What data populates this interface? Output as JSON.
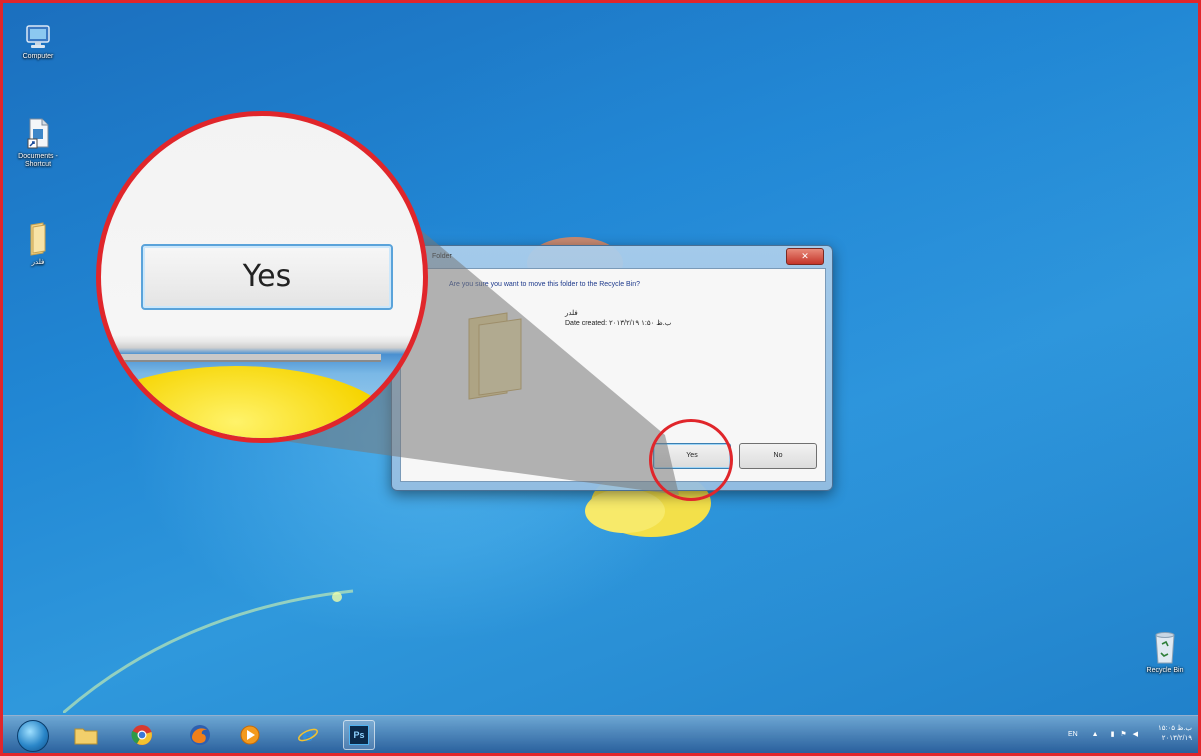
{
  "desktop": {
    "icons": [
      {
        "name": "computer",
        "label": "Computer"
      },
      {
        "name": "documents",
        "label": "Documents - Shortcut"
      },
      {
        "name": "folder",
        "label": "فلدر"
      },
      {
        "name": "recycle-bin",
        "label": "Recycle Bin"
      }
    ]
  },
  "dialog": {
    "title": "Folder",
    "close_label": "✕",
    "question": "Are you sure you want to move this folder to the Recycle Bin?",
    "folder_name": "فلدر",
    "date_created": "Date created: ۲۰۱۳/۲/۱۹ ب.ظ ۱:۵۰",
    "yes_label": "Yes",
    "no_label": "No"
  },
  "magnifier": {
    "yes_label": "Yes"
  },
  "taskbar": {
    "apps": [
      "windows-explorer",
      "chrome",
      "firefox",
      "media-player",
      "internet-explorer",
      "photoshop"
    ],
    "photoshop_label": "Ps",
    "tray_lang": "EN",
    "clock_time": "۱۵:۰۵ ب.ظ",
    "clock_date": "۲۰۱۳/۲/۱۹"
  },
  "colors": {
    "highlight": "#e0262b",
    "desktop_blue": "#2187d4"
  }
}
